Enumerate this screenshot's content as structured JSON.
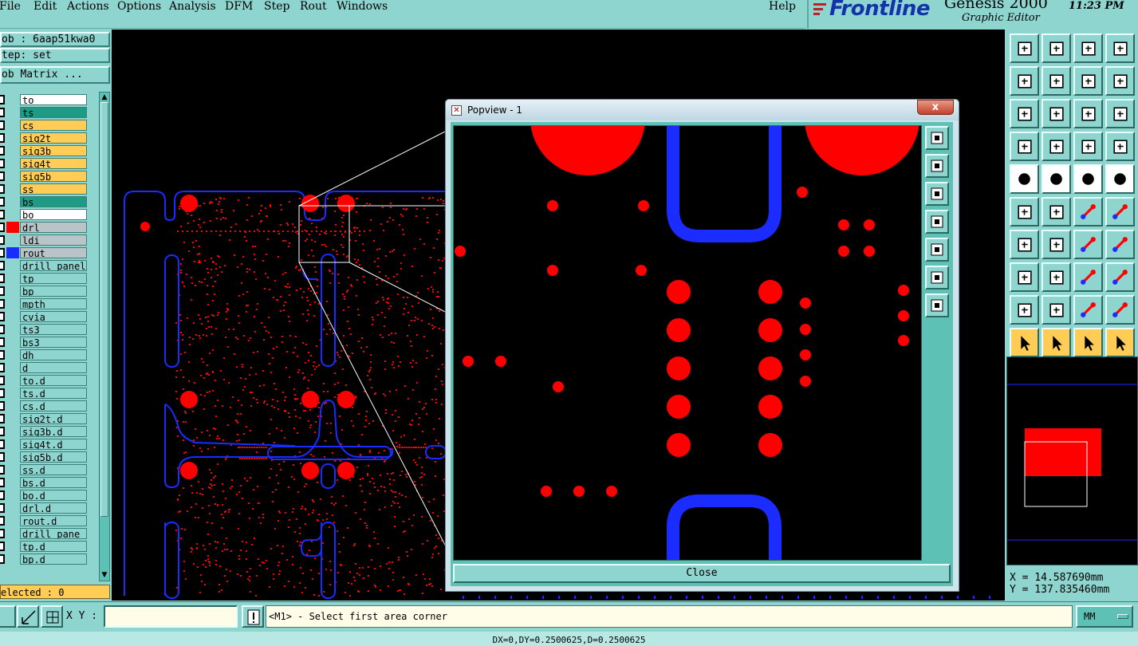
{
  "menu": {
    "items": [
      "File",
      "Edit",
      "Actions",
      "Options",
      "Analysis",
      "DFM",
      "Step",
      "Rout",
      "Windows"
    ],
    "help": "Help"
  },
  "brand": {
    "logo": "Frontline",
    "product": "Genesis 2000",
    "subtitle": "Graphic Editor",
    "clock": "11:23 PM"
  },
  "left": {
    "job": "ob : 6aap51kwa0",
    "step": "tep: set",
    "job_matrix": "ob Matrix ...",
    "layers": [
      {
        "name": "to",
        "color": "#ffffff",
        "swatch": ""
      },
      {
        "name": "ts",
        "color": "#1f9a84",
        "swatch": ""
      },
      {
        "name": "cs",
        "color": "#ffcc55",
        "swatch": ""
      },
      {
        "name": "sig2t",
        "color": "#ffcc55",
        "swatch": ""
      },
      {
        "name": "sig3b",
        "color": "#ffcc55",
        "swatch": ""
      },
      {
        "name": "sig4t",
        "color": "#ffcc55",
        "swatch": ""
      },
      {
        "name": "sig5b",
        "color": "#ffcc55",
        "swatch": ""
      },
      {
        "name": "ss",
        "color": "#ffcc55",
        "swatch": ""
      },
      {
        "name": "bs",
        "color": "#1f9a84",
        "swatch": ""
      },
      {
        "name": "bo",
        "color": "#ffffff",
        "swatch": ""
      },
      {
        "name": "drl",
        "color": "#b8c4c8",
        "swatch": "#ff0000"
      },
      {
        "name": "ldi",
        "color": "#b8c4c8",
        "swatch": ""
      },
      {
        "name": "rout",
        "color": "#b8c4c8",
        "swatch": "#1a2cff"
      },
      {
        "name": "drill_panel",
        "color": "#8ed5cf",
        "swatch": ""
      },
      {
        "name": "tp",
        "color": "#8ed5cf",
        "swatch": ""
      },
      {
        "name": "bp",
        "color": "#8ed5cf",
        "swatch": ""
      },
      {
        "name": "mpth",
        "color": "#8ed5cf",
        "swatch": ""
      },
      {
        "name": "cvia",
        "color": "#8ed5cf",
        "swatch": ""
      },
      {
        "name": "ts3",
        "color": "#8ed5cf",
        "swatch": ""
      },
      {
        "name": "bs3",
        "color": "#8ed5cf",
        "swatch": ""
      },
      {
        "name": "dh",
        "color": "#8ed5cf",
        "swatch": ""
      },
      {
        "name": "d",
        "color": "#8ed5cf",
        "swatch": ""
      },
      {
        "name": "to.d",
        "color": "#8ed5cf",
        "swatch": ""
      },
      {
        "name": "ts.d",
        "color": "#8ed5cf",
        "swatch": ""
      },
      {
        "name": "cs.d",
        "color": "#8ed5cf",
        "swatch": ""
      },
      {
        "name": "sig2t.d",
        "color": "#8ed5cf",
        "swatch": ""
      },
      {
        "name": "sig3b.d",
        "color": "#8ed5cf",
        "swatch": ""
      },
      {
        "name": "sig4t.d",
        "color": "#8ed5cf",
        "swatch": ""
      },
      {
        "name": "sig5b.d",
        "color": "#8ed5cf",
        "swatch": ""
      },
      {
        "name": "ss.d",
        "color": "#8ed5cf",
        "swatch": ""
      },
      {
        "name": "bs.d",
        "color": "#8ed5cf",
        "swatch": ""
      },
      {
        "name": "bo.d",
        "color": "#8ed5cf",
        "swatch": ""
      },
      {
        "name": "drl.d",
        "color": "#8ed5cf",
        "swatch": ""
      },
      {
        "name": "rout.d",
        "color": "#8ed5cf",
        "swatch": ""
      },
      {
        "name": "drill_pane",
        "color": "#8ed5cf",
        "swatch": ""
      },
      {
        "name": "tp.d",
        "color": "#8ed5cf",
        "swatch": ""
      },
      {
        "name": "bp.d",
        "color": "#8ed5cf",
        "swatch": ""
      }
    ],
    "selected": "elected : 0"
  },
  "popview": {
    "title": "Popview - 1",
    "close_x": "x",
    "close_button": "Close"
  },
  "coords": {
    "x": "X = 14.587690mm",
    "y": "Y = 137.835460mm"
  },
  "bottom": {
    "xy_label": "X Y :",
    "xy_value": "",
    "prompt": "<M1> - Select first area corner",
    "units": "MM",
    "status": "DX=0,DY=0.2500625,D=0.2500625"
  },
  "colors": {
    "pad": "#ff0000",
    "rout": "#1a2cff",
    "panel_bg": "#8ed5cf"
  }
}
